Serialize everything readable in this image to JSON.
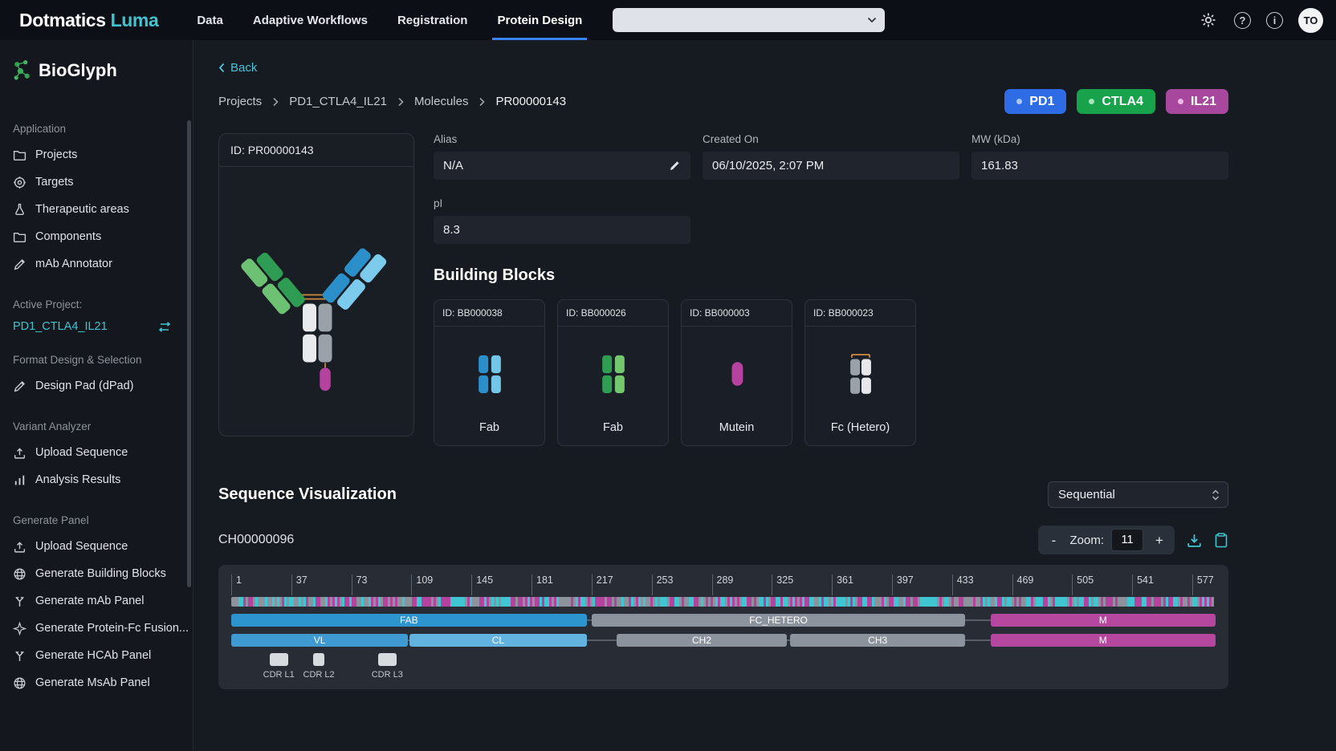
{
  "navbar": {
    "brand_name": "Dotmatics",
    "brand_suffix": "Luma",
    "items": [
      {
        "label": "Data",
        "active": false
      },
      {
        "label": "Adaptive Workflows",
        "active": false
      },
      {
        "label": "Registration",
        "active": false
      },
      {
        "label": "Protein Design",
        "active": true
      }
    ],
    "icon_buttons": [
      {
        "name": "settings"
      },
      {
        "name": "help",
        "glyph": "?"
      },
      {
        "name": "info",
        "glyph": "i"
      }
    ],
    "avatar": "TO",
    "accent_color": "#41c4d0",
    "active_tab_color": "#3b82f6"
  },
  "sidebar": {
    "app_title": "BioGlyph",
    "sections": [
      {
        "header": "Application",
        "items": [
          {
            "label": "Projects",
            "icon": "folder"
          },
          {
            "label": "Targets",
            "icon": "target"
          },
          {
            "label": "Therapeutic areas",
            "icon": "flask"
          },
          {
            "label": "Components",
            "icon": "folder"
          },
          {
            "label": "mAb Annotator",
            "icon": "pen"
          }
        ]
      },
      {
        "header": "Active Project:",
        "project": "PD1_CTLA4_IL21"
      },
      {
        "header": "Format Design & Selection",
        "items": [
          {
            "label": "Design Pad (dPad)",
            "icon": "pen"
          }
        ]
      },
      {
        "header": "Variant Analyzer",
        "items": [
          {
            "label": "Upload Sequence",
            "icon": "upload"
          },
          {
            "label": "Analysis Results",
            "icon": "bars"
          }
        ]
      },
      {
        "header": "Generate Panel",
        "items": [
          {
            "label": "Upload Sequence",
            "icon": "upload"
          },
          {
            "label": "Generate Building Blocks",
            "icon": "globe"
          },
          {
            "label": "Generate mAb Panel",
            "icon": "yshape"
          },
          {
            "label": "Generate Protein-Fc Fusion...",
            "icon": "sparkle"
          },
          {
            "label": "Generate HCAb Panel",
            "icon": "yshape"
          },
          {
            "label": "Generate MsAb Panel",
            "icon": "globe"
          }
        ]
      }
    ]
  },
  "main": {
    "back_label": "Back",
    "breadcrumb": [
      "Projects",
      "PD1_CTLA4_IL21",
      "Molecules",
      "PR00000143"
    ],
    "badges": [
      {
        "label": "PD1",
        "bg": "#2d6ce5",
        "dot": "#a9c7ff"
      },
      {
        "label": "CTLA4",
        "bg": "#17a24b",
        "dot": "#a0e8b6"
      },
      {
        "label": "IL21",
        "bg": "#a8479e",
        "dot": "#ecb9e4"
      }
    ],
    "molecule_card": {
      "id_label": "ID: PR00000143"
    },
    "fields": {
      "alias": {
        "label": "Alias",
        "value": "N/A"
      },
      "created_on": {
        "label": "Created On",
        "value": "06/10/2025, 2:07 PM"
      },
      "mw": {
        "label": "MW (kDa)",
        "value": "161.83"
      },
      "pi": {
        "label": "pI",
        "value": "8.3"
      }
    },
    "building_blocks": {
      "heading": "Building Blocks",
      "cards": [
        {
          "id": "ID: BB000038",
          "label": "Fab",
          "icon": "fab-blue"
        },
        {
          "id": "ID: BB000026",
          "label": "Fab",
          "icon": "fab-green"
        },
        {
          "id": "ID: BB000003",
          "label": "Mutein",
          "icon": "mutein"
        },
        {
          "id": "ID: BB000023",
          "label": "Fc (Hetero)",
          "icon": "fc-hetero"
        }
      ]
    },
    "sequence": {
      "heading": "Sequence Visualization",
      "mode": "Sequential",
      "chain_id": "CH00000096",
      "zoom": {
        "minus": "-",
        "label": "Zoom:",
        "value": "11",
        "plus": "+"
      },
      "total_residues": 590,
      "ruler_ticks": [
        1,
        37,
        73,
        109,
        145,
        181,
        217,
        253,
        289,
        325,
        361,
        397,
        433,
        469,
        505,
        541,
        577
      ],
      "mosaic_palette": [
        "#3fc6d2",
        "#2f9e53",
        "#2b8fc9",
        "#8e44ad",
        "#b5429f",
        "#d35454",
        "#cf8b3e",
        "#cfc24a",
        "#8d939c",
        "#74c6e8",
        "#74c66f",
        "#5561c9"
      ],
      "tracks": [
        {
          "segments": [
            {
              "label": "FAB",
              "start": 1,
              "end": 213,
              "color": "#2d94cd"
            },
            {
              "label": "FC_HETERO",
              "start": 217,
              "end": 440,
              "color": "#8d939c"
            },
            {
              "label": "M",
              "start": 456,
              "end": 590,
              "color": "#b5479f"
            }
          ]
        },
        {
          "segments": [
            {
              "label": "VL",
              "start": 1,
              "end": 106,
              "color": "#3e9ad1"
            },
            {
              "label": "CL",
              "start": 108,
              "end": 213,
              "color": "#62b3e0"
            },
            {
              "label": "CH2",
              "start": 232,
              "end": 333,
              "color": "#8d939c"
            },
            {
              "label": "CH3",
              "start": 336,
              "end": 440,
              "color": "#8d939c"
            },
            {
              "label": "M",
              "start": 456,
              "end": 590,
              "color": "#b5479f"
            }
          ]
        }
      ],
      "cdrs": [
        {
          "label": "CDR L1",
          "start": 24,
          "end": 34
        },
        {
          "label": "CDR L2",
          "start": 50,
          "end": 56
        },
        {
          "label": "CDR L3",
          "start": 89,
          "end": 99
        }
      ]
    }
  }
}
